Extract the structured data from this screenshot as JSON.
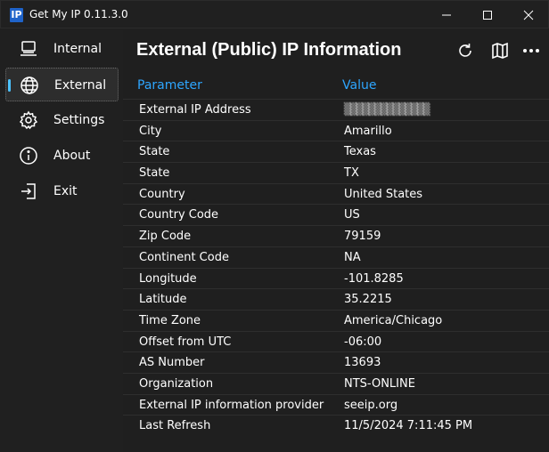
{
  "window": {
    "app_icon_text": "IP",
    "title": "Get My IP   0.11.3.0",
    "controls": [
      "minimize-icon",
      "maximize-icon",
      "close-icon"
    ]
  },
  "sidebar": {
    "items": [
      {
        "label": "Internal",
        "icon": "computer-icon",
        "active": false
      },
      {
        "label": "External",
        "icon": "globe-icon",
        "active": true
      },
      {
        "label": "Settings",
        "icon": "gear-icon",
        "active": false
      },
      {
        "label": "About",
        "icon": "info-icon",
        "active": false
      },
      {
        "label": "Exit",
        "icon": "exit-icon",
        "active": false
      }
    ]
  },
  "main": {
    "title": "External (Public) IP Information",
    "toolbar": [
      "refresh-icon",
      "map-icon",
      "more-icon"
    ],
    "columns": {
      "parameter": "Parameter",
      "value": "Value"
    },
    "rows": [
      {
        "parameter": "External IP Address",
        "value": "▒▒▒▒▒▒▒▒▒▒▒▒▒▒",
        "obscured": true
      },
      {
        "parameter": "City",
        "value": "Amarillo"
      },
      {
        "parameter": "State",
        "value": "Texas"
      },
      {
        "parameter": "State",
        "value": "TX"
      },
      {
        "parameter": "Country",
        "value": "United States"
      },
      {
        "parameter": "Country Code",
        "value": "US"
      },
      {
        "parameter": "Zip Code",
        "value": "79159"
      },
      {
        "parameter": "Continent Code",
        "value": "NA"
      },
      {
        "parameter": "Longitude",
        "value": "-101.8285"
      },
      {
        "parameter": "Latitude",
        "value": "35.2215"
      },
      {
        "parameter": "Time Zone",
        "value": "America/Chicago"
      },
      {
        "parameter": "Offset from UTC",
        "value": "-06:00"
      },
      {
        "parameter": "AS Number",
        "value": "13693"
      },
      {
        "parameter": "Organization",
        "value": "NTS-ONLINE"
      },
      {
        "parameter": "External IP information provider",
        "value": "seeip.org"
      },
      {
        "parameter": "Last Refresh",
        "value": "11/5/2024 7:11:45 PM"
      }
    ]
  },
  "colors": {
    "accent": "#4cc2ff",
    "header_text": "#2ea6ff",
    "background": "#202020"
  }
}
